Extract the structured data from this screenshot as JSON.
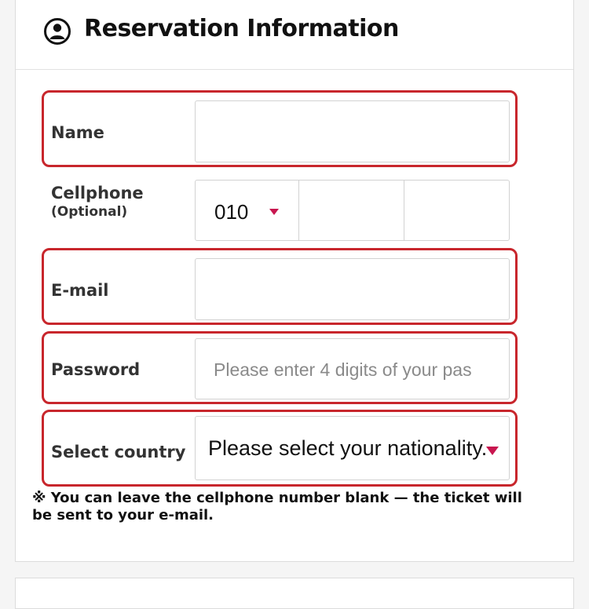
{
  "header": {
    "title": "Reservation Information",
    "icon": "user-circle-icon"
  },
  "form": {
    "name": {
      "label": "Name",
      "value": ""
    },
    "cellphone": {
      "label": "Cellphone",
      "sublabel": "(Optional)",
      "prefix": "010",
      "middle": "",
      "last": ""
    },
    "email": {
      "label": "E-mail",
      "value": ""
    },
    "password": {
      "label": "Password",
      "placeholder": "Please enter 4 digits of your pas"
    },
    "country": {
      "label": "Select country",
      "selected": "Please select your nationality."
    }
  },
  "note": "※ You can leave the cellphone number blank — the ticket will be sent to your e-mail.",
  "colors": {
    "highlight": "#c8262c",
    "caret": "#c8164f"
  }
}
